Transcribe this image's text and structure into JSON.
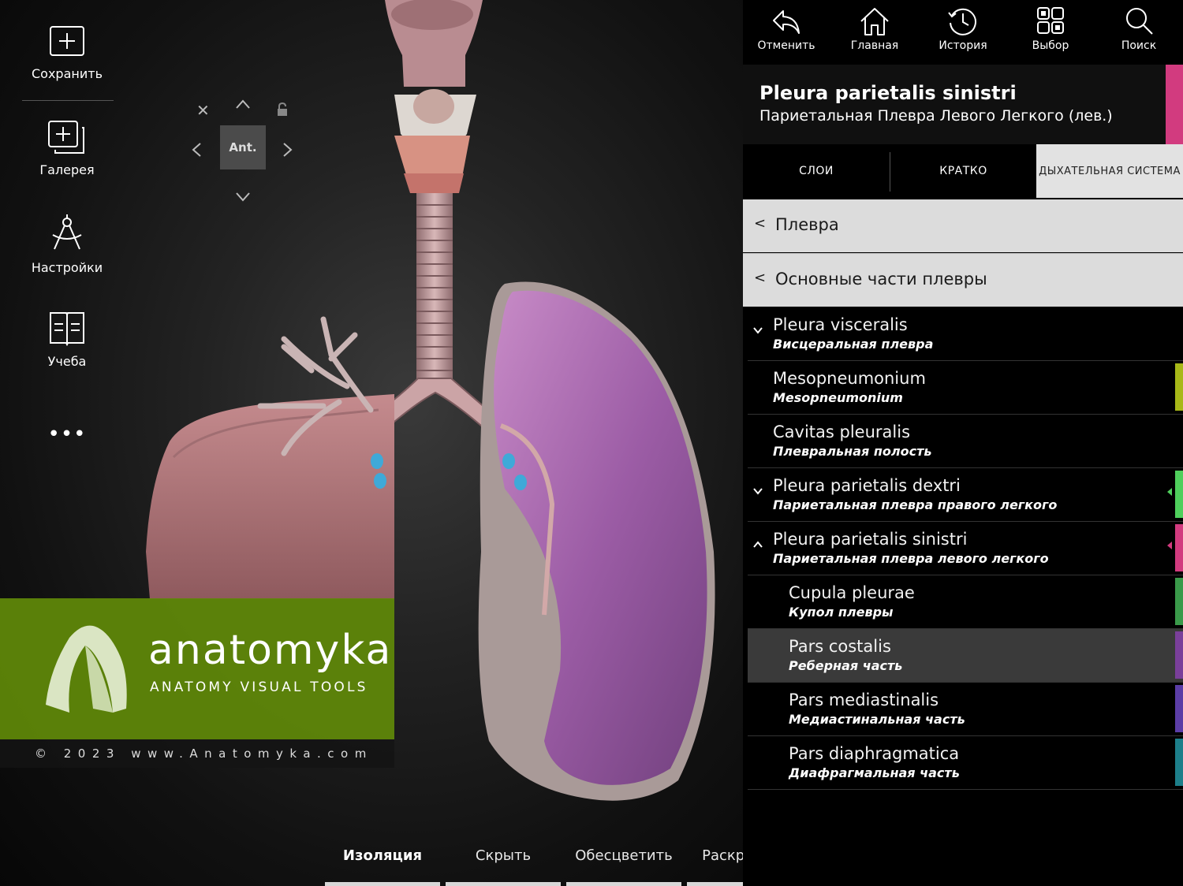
{
  "sidebar": {
    "items": [
      {
        "label": "Сохранить",
        "icon": "plus-square-icon"
      },
      {
        "label": "Галерея",
        "icon": "gallery-add-icon"
      },
      {
        "label": "Настройки",
        "icon": "compass-icon"
      },
      {
        "label": "Учеба",
        "icon": "book-icon"
      }
    ],
    "more": "•••"
  },
  "navcube": {
    "face": "Ant.",
    "icons": [
      "close-icon",
      "lock-icon",
      "chevron-up-icon",
      "chevron-down-icon",
      "chevron-left-icon",
      "chevron-right-icon"
    ]
  },
  "watermark": {
    "name": "anatomyka",
    "tagline": "ANATOMY VISUAL TOOLS",
    "copyright": "© 2023 www.Anatomyka.com",
    "color": "#608909"
  },
  "bottom_bar": {
    "buttons": [
      {
        "label": "Изоляция",
        "active": true
      },
      {
        "label": "Скрыть"
      },
      {
        "label": "Обесцветить"
      },
      {
        "label": "Раскрасить"
      }
    ]
  },
  "toolbar": {
    "buttons": [
      {
        "label": "Отменить",
        "icon": "undo-icon"
      },
      {
        "label": "Главная",
        "icon": "home-icon"
      },
      {
        "label": "История",
        "icon": "history-icon"
      },
      {
        "label": "Выбор",
        "icon": "grid-select-icon"
      },
      {
        "label": "Поиск",
        "icon": "search-icon"
      }
    ]
  },
  "header": {
    "title": "Pleura parietalis sinistri",
    "subtitle": "Париетальная Плевра Левого Легкого (лев.)",
    "accent": "#d23b7f"
  },
  "tabs": [
    {
      "label": "СЛОИ"
    },
    {
      "label": "КРАТКО"
    },
    {
      "label": "ДЫХАТЕЛЬНАЯ СИСТЕМА",
      "active": true
    }
  ],
  "breadcrumbs": [
    {
      "label": "Плевра"
    },
    {
      "label": "Основные части плевры"
    }
  ],
  "list": [
    {
      "latin": "Pleura visceralis",
      "russian": "Висцеральная плевра",
      "expand": "down",
      "color": null
    },
    {
      "latin": "Mesopneumonium",
      "russian": "Mesopneumonium",
      "color": "#a8b818"
    },
    {
      "latin": "Cavitas pleuralis",
      "russian": "Плевральная полость",
      "color": null
    },
    {
      "latin": "Pleura parietalis dextri",
      "russian": "Париетальная плевра правого легкого",
      "expand": "down",
      "color": "#4fcf5c"
    },
    {
      "latin": "Pleura parietalis sinistri",
      "russian": "Париетальная плевра левого легкого",
      "expand": "up",
      "color": "#d23b7f"
    },
    {
      "latin": "Cupula pleurae",
      "russian": "Купол плевры",
      "color": "#3a9a4a",
      "indent": true
    },
    {
      "latin": "Pars costalis",
      "russian": "Реберная часть",
      "color": "#7a3f9a",
      "indent": true,
      "selected": true
    },
    {
      "latin": "Pars mediastinalis",
      "russian": "Медиастинальная часть",
      "color": "#5b3da6",
      "indent": true
    },
    {
      "latin": "Pars diaphragmatica",
      "russian": "Диафрагмальная часть",
      "color": "#1d7f8a",
      "indent": true
    }
  ]
}
